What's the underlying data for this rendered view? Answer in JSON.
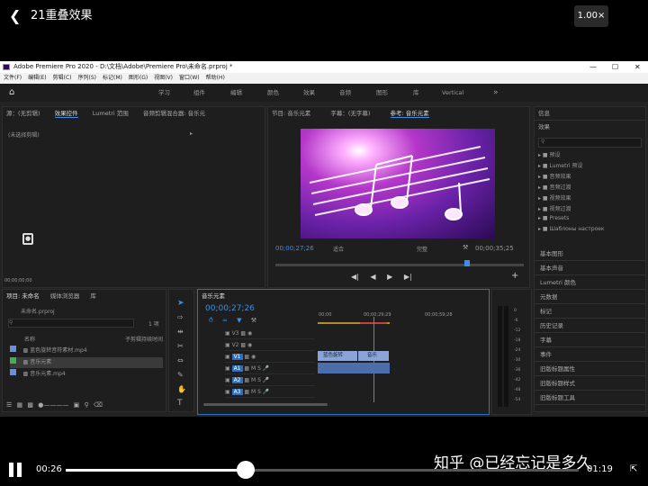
{
  "player": {
    "title": "21重叠效果",
    "speed": "1.00×",
    "current_time": "00:26",
    "total_time": "01:19",
    "progress": 0.35,
    "watermark": "知乎 @已经忘记是多久"
  },
  "app": {
    "title": "Adobe Premiere Pro 2020 - D:\\文档\\Adobe\\Premiere Pro\\未命名.prproj *",
    "menu": [
      "文件(F)",
      "编辑(E)",
      "剪辑(C)",
      "序列(S)",
      "标记(M)",
      "图形(G)",
      "视图(V)",
      "窗口(W)",
      "帮助(H)"
    ],
    "workspaces": [
      "学习",
      "组件",
      "编辑",
      "颜色",
      "效果",
      "音频",
      "图形",
      "库",
      "Vertical"
    ],
    "source_tabs": [
      "源：(无剪辑)",
      "效果控件",
      "Lumetri 范围",
      "音频剪辑混合器: 音乐元"
    ],
    "no_clip": "(未选择剪辑)",
    "source_tc": "00;00;00;00",
    "program_tabs": [
      "节目: 音乐元素",
      "字幕：(无字幕)",
      "参考: 音乐元素"
    ],
    "program_tc": "00;00;27;26",
    "fit": "适合",
    "full": "完整",
    "program_duration": "00;00;35;25",
    "project_tabs": [
      "项目: 未命名",
      "媒体浏览器",
      "库"
    ],
    "project_file": "未命名.prproj",
    "item_count": "1 项",
    "col_name": "名称",
    "col_rate": "子剪辑持续时间",
    "project_items": [
      "蓝色旋转音符素材.mp4",
      "音乐元素",
      "音乐元素.mp4"
    ],
    "timeline_tab": "音乐元素",
    "timeline_tc": "00;00;27;26",
    "ruler": [
      "00;00",
      "00;00;29;29",
      "00;00;59;28"
    ],
    "tracks": [
      "V3",
      "V2",
      "V1",
      "A1",
      "A2",
      "A3"
    ],
    "clips": [
      "蓝色旋转",
      "音乐"
    ],
    "effects_header": "效果",
    "info_header": "信息",
    "effects_folders": [
      "预设",
      "Lumetri 预设",
      "音频效果",
      "音频过渡",
      "视频效果",
      "视频过渡",
      "Presets",
      "Шаблоны настроек"
    ],
    "right_items": [
      "基本图形",
      "基本声音",
      "Lumetri 颜色",
      "元数据",
      "标记",
      "历史记录",
      "字幕",
      "事件",
      "旧版标题属性",
      "旧版标题样式",
      "旧版标题工具"
    ],
    "meter": [
      "0",
      "-6",
      "-12",
      "-18",
      "-24",
      "-30",
      "-36",
      "-42",
      "-48",
      "-54"
    ]
  }
}
